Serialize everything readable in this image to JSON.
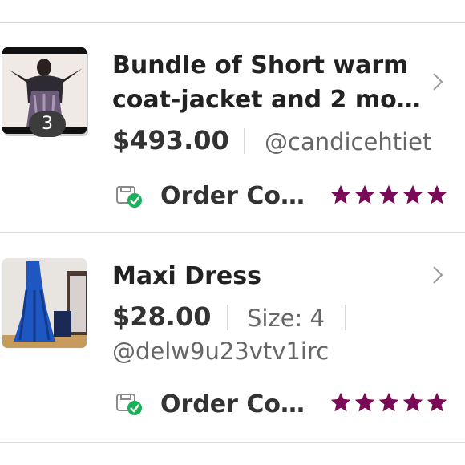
{
  "colors": {
    "star": "#7a0a57",
    "text": "#222222",
    "muted": "#666666",
    "divider": "#dcdcdc",
    "status_check": "#1bb05a"
  },
  "orders": [
    {
      "title_line1": "Bundle of Short  warm",
      "title_line2": "coat-jacket and 2 mo…",
      "item_count": "3",
      "price": "$493.00",
      "seller": "@candicehtiet",
      "status": "Order Co…",
      "rating": 5
    },
    {
      "title_line1": "Maxi Dress",
      "price": "$28.00",
      "size": "Size: 4",
      "seller": "@delw9u23vtv1irc",
      "status": "Order Co…",
      "rating": 5
    }
  ]
}
